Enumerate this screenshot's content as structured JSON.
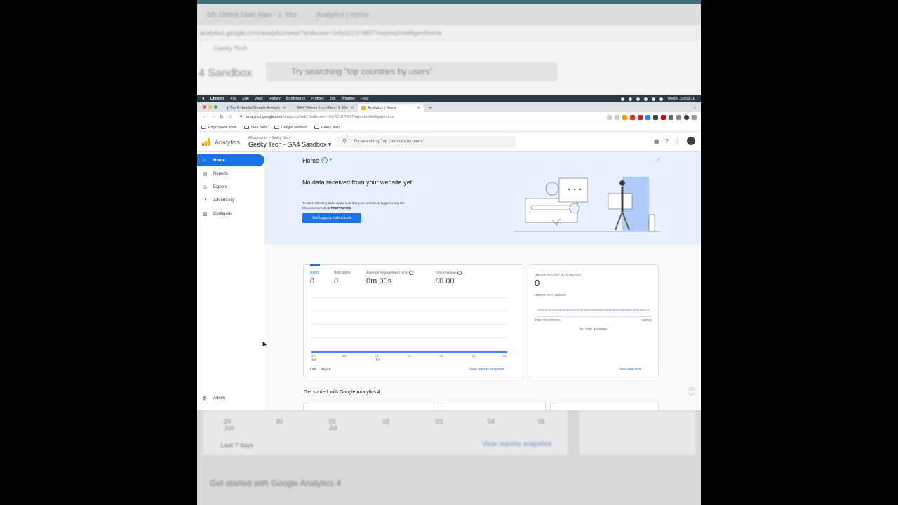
{
  "background": {
    "tab1": "5th Oldest Date Alan - 1. Mor",
    "tab2": "Analytics | Home",
    "url": "analytics.google.com/analytics/web/?authuser=1#/p321974827/reports/intelligenthome",
    "breadcrumb": "Geeky Tech",
    "title": "4 Sandbox",
    "search": "Try searching \"top countries by users\"",
    "axis": [
      "29",
      "30",
      "01",
      "02",
      "03",
      "04",
      "05"
    ],
    "axis_sub": "Jun",
    "axis_sub2": "Jul",
    "period": "Last 7 days",
    "link": "View reports snapshot",
    "section": "Get started with Google Analytics 4"
  },
  "macbar": {
    "menus": [
      "Chrome",
      "File",
      "Edit",
      "View",
      "History",
      "Bookmarks",
      "Profiles",
      "Tab",
      "Window",
      "Help"
    ],
    "clock": "Wed 6 Jul  09:16"
  },
  "tabs": [
    {
      "label": "Top 6 Helpful Google Analytic",
      "color": "#4285f4"
    },
    {
      "label": "GA4 Videos from Alan - 1. Mo",
      "color": "#34a853"
    },
    {
      "label": "Analytics | Home",
      "color": "#f9ab00"
    }
  ],
  "urlbar": {
    "host": "analytics.google.com",
    "path": "/analytics/web/?authuser=1#/p321974827/reports/intelligenthome"
  },
  "bookmarks": [
    "Page Speed Tools",
    "SEO Tools",
    "Google Services",
    "Geeky Tech"
  ],
  "header": {
    "brand": "Analytics",
    "crumb": "All accounts > Geeky Tech",
    "account": "Geeky Tech - GA4 Sandbox ▾",
    "search_placeholder": "Try searching \"top countries by users\""
  },
  "sidebar": {
    "items": [
      {
        "label": "Home",
        "icon": "home-icon"
      },
      {
        "label": "Reports",
        "icon": "reports-icon"
      },
      {
        "label": "Explore",
        "icon": "explore-icon"
      },
      {
        "label": "Advertising",
        "icon": "advertising-icon"
      },
      {
        "label": "Configure",
        "icon": "configure-icon"
      }
    ],
    "admin": "Admin"
  },
  "hero": {
    "title": "Home",
    "heading": "No data received from your website yet.",
    "body": "To start collecting data, make sure that your website is tagged using the Measurement ID",
    "measurement_id": "G-TC6T7NZYC1",
    "button": "Get tagging instructions"
  },
  "overview": {
    "metrics": [
      {
        "label": "Users",
        "value": "0"
      },
      {
        "label": "New users",
        "value": "0"
      },
      {
        "label": "Average engagement time",
        "value": "0m 00s"
      },
      {
        "label": "Total revenue",
        "value": "£0.00"
      }
    ],
    "axis": [
      "29",
      "30",
      "01",
      "02",
      "03",
      "04",
      "05"
    ],
    "axis_month_jun": "Jun",
    "axis_month_jul": "Jul",
    "period": "Last 7 days ▾",
    "link": "View reports snapshot →"
  },
  "realtime": {
    "title": "USERS IN LAST 30 MINUTES",
    "value": "0",
    "sub": "USERS PER MINUTE",
    "col1": "TOP COUNTRIES",
    "col2": "USERS",
    "empty": "No data available",
    "link": "View real time →"
  },
  "section": {
    "title": "Get started with Google Analytics 4"
  },
  "colors": {
    "accent": "#1a73e8",
    "hero_bg": "#e8f0fe"
  }
}
